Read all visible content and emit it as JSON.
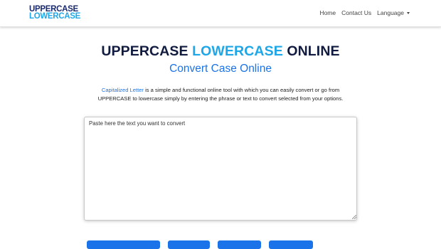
{
  "header": {
    "logo_line1": "UPPERCASE",
    "logo_line2": "LOWERCASE",
    "nav": {
      "home": "Home",
      "contact": "Contact Us",
      "language": "Language"
    }
  },
  "hero": {
    "title_part1": "UPPERCASE",
    "title_part2": "LOWERCASE",
    "title_part3": "ONLINE",
    "subtitle": "Convert Case Online"
  },
  "description": {
    "link_text": "Capitalized Letter",
    "text": " is a simple and functional online tool with which you can easily convert or go from UPPERCASE to lowercase simply by entering the phrase or text to convert selected from your options."
  },
  "editor": {
    "placeholder": "Paste here the text you want to convert",
    "value": ""
  },
  "colors": {
    "navy": "#111b3f",
    "accent_cyan": "#1ea7e8",
    "link_blue": "#1a73e8"
  }
}
